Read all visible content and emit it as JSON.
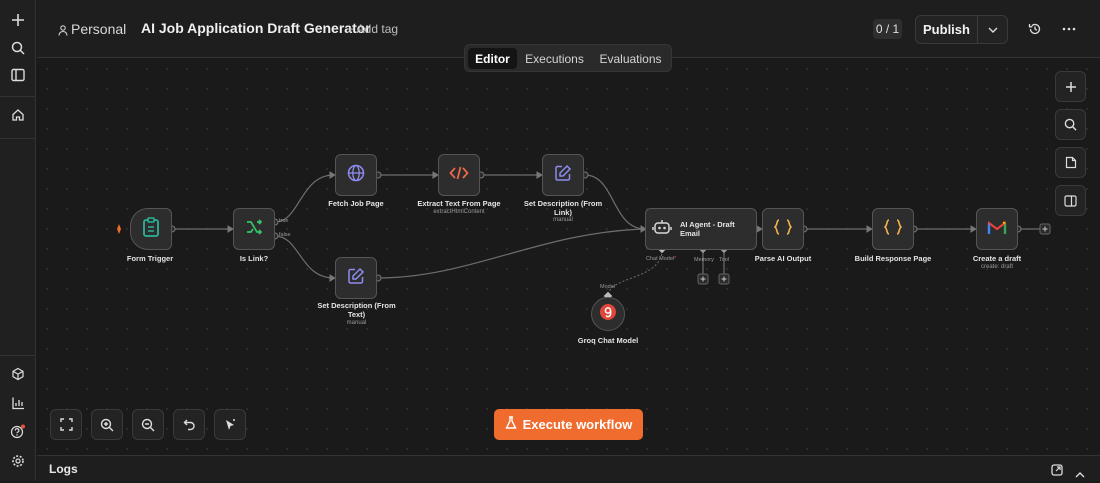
{
  "header": {
    "project": "Personal",
    "title": "AI Job Application Draft Generator",
    "add_tag": "+ Add tag",
    "counter": "0 / 1",
    "publish": "Publish"
  },
  "tabs": [
    "Editor",
    "Executions",
    "Evaluations"
  ],
  "active_tab": "Editor",
  "nodes": {
    "form_trigger": {
      "label": "Form Trigger"
    },
    "is_link": {
      "label": "Is Link?",
      "out_true": "true",
      "out_false": "false"
    },
    "fetch_job_page": {
      "label": "Fetch Job Page"
    },
    "extract_text": {
      "label": "Extract Text From Page",
      "sub": "extractHtmlContent"
    },
    "set_desc_link": {
      "label": "Set Description (From Link)",
      "sub": "manual"
    },
    "set_desc_text": {
      "label": "Set Description (From Text)",
      "sub": "manual"
    },
    "ai_agent": {
      "label": "AI Agent - Draft Email",
      "port_chat_model": "Chat Model",
      "port_memory": "Memory",
      "port_tool": "Tool"
    },
    "groq": {
      "label": "Groq Chat Model",
      "port_model": "Model"
    },
    "parse_ai": {
      "label": "Parse AI Output"
    },
    "build_response": {
      "label": "Build Response Page"
    },
    "create_draft": {
      "label": "Create a draft",
      "sub": "create: draft"
    }
  },
  "execute_button": "Execute workflow",
  "logs": {
    "label": "Logs"
  },
  "colors": {
    "accent": "#ef6b2e",
    "trigger_icon": "#2bb39a",
    "if_icon": "#35c46b",
    "globe_icon": "#8f8cf0",
    "code_icon": "#f06a4a",
    "edit_icon": "#8f8cf0",
    "json_icon": "#f0b34a"
  }
}
